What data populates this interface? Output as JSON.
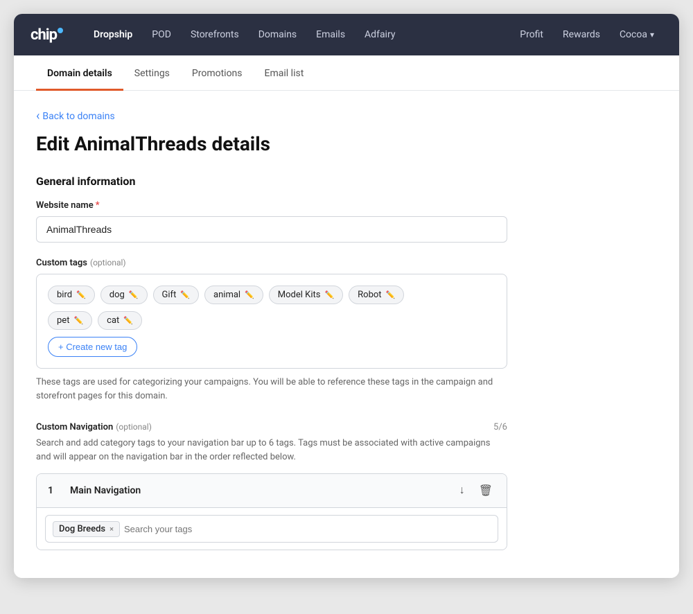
{
  "topnav": {
    "logo": "chip",
    "links": [
      {
        "label": "Dropship",
        "active": true
      },
      {
        "label": "POD",
        "active": false
      },
      {
        "label": "Storefronts",
        "active": false
      },
      {
        "label": "Domains",
        "active": false
      },
      {
        "label": "Emails",
        "active": false
      },
      {
        "label": "Adfairy",
        "active": false
      }
    ],
    "right_links": [
      {
        "label": "Profit"
      },
      {
        "label": "Rewards"
      },
      {
        "label": "Cocoa"
      }
    ]
  },
  "tabs": [
    {
      "label": "Domain details",
      "active": true
    },
    {
      "label": "Settings",
      "active": false
    },
    {
      "label": "Promotions",
      "active": false
    },
    {
      "label": "Email list",
      "active": false
    }
  ],
  "back_label": "Back to domains",
  "page_title": "Edit AnimalThreads details",
  "sections": {
    "general": {
      "title": "General information",
      "website_name_label": "Website name",
      "website_name_value": "AnimalThreads",
      "website_name_placeholder": "AnimalThreads"
    },
    "custom_tags": {
      "title": "Custom tags",
      "optional": "(optional)",
      "tags": [
        "bird",
        "dog",
        "Gift",
        "animal",
        "Model Kits",
        "Robot",
        "pet",
        "cat"
      ],
      "create_btn": "+ Create new tag",
      "hint": "These tags are used for categorizing your campaigns. You will be able to reference these tags in the campaign and storefront pages for this domain."
    },
    "custom_nav": {
      "title": "Custom Navigation",
      "optional": "(optional)",
      "count": "5/6",
      "hint": "Search and add category tags to your navigation bar up to 6 tags. Tags must be associated with active campaigns and will appear on the navigation bar in the order reflected below.",
      "nav_items": [
        {
          "num": "1",
          "name": "Main Navigation",
          "selected_tags": [
            {
              "label": "Dog Breeds"
            }
          ],
          "search_placeholder": "Search your tags"
        }
      ]
    }
  }
}
